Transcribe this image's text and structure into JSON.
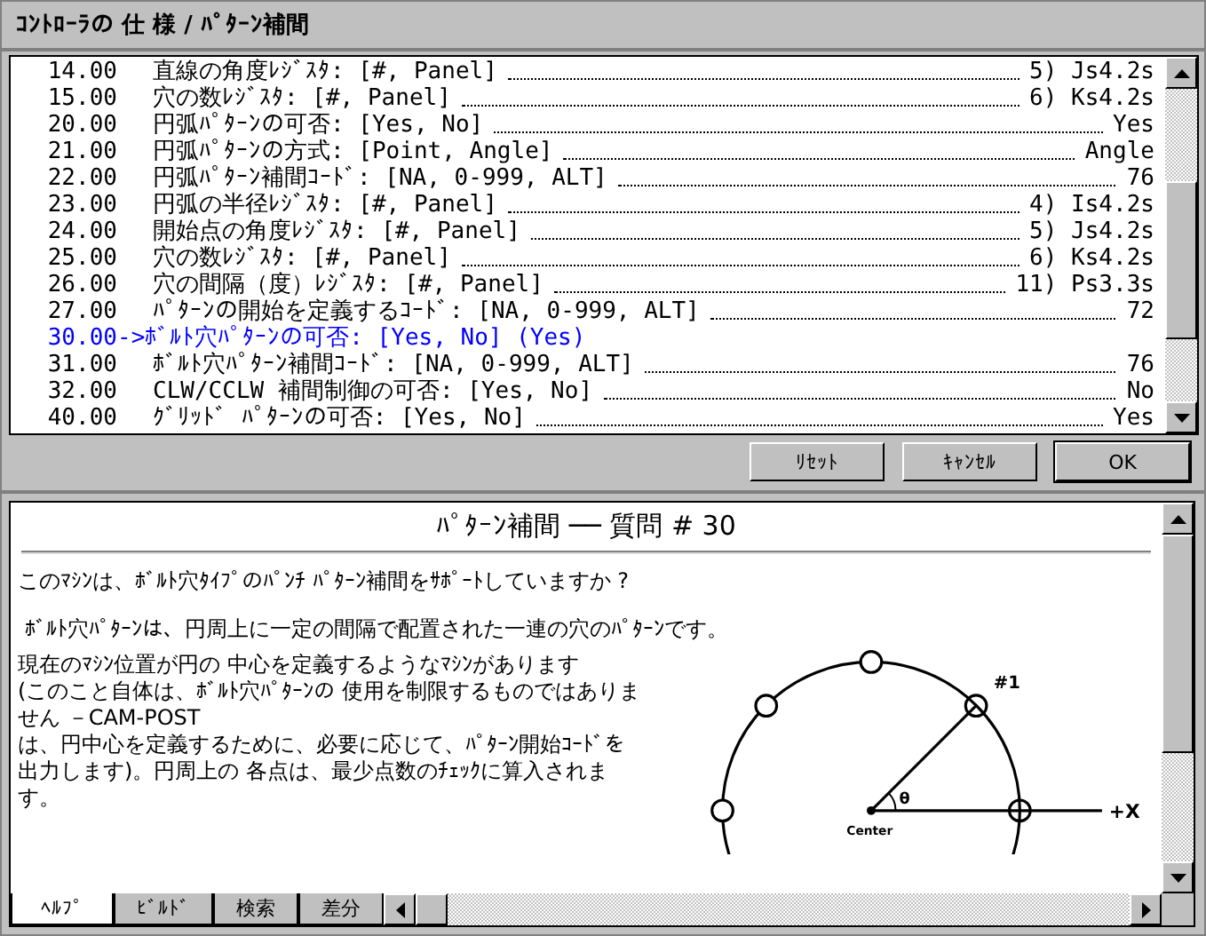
{
  "window": {
    "title": "ｺﾝﾄﾛｰﾗの 仕 様 / ﾊﾟﾀｰﾝ補間"
  },
  "rows": [
    {
      "number": "14.00",
      "text": "直線の角度ﾚｼﾞｽﾀ: [#, Panel]",
      "value": "5)  Js4.2s",
      "selected": false
    },
    {
      "number": "15.00",
      "text": "穴の数ﾚｼﾞｽﾀ: [#, Panel]",
      "value": "6)  Ks4.2s",
      "selected": false
    },
    {
      "number": "20.00",
      "text": "円弧ﾊﾟﾀｰﾝの可否: [Yes, No]",
      "value": "Yes",
      "selected": false
    },
    {
      "number": "21.00",
      "text": "円弧ﾊﾟﾀｰﾝの方式: [Point, Angle]",
      "value": "Angle",
      "selected": false
    },
    {
      "number": "22.00",
      "text": "円弧ﾊﾟﾀｰﾝ補間ｺｰﾄﾞ: [NA, 0-999, ALT]",
      "value": "76",
      "selected": false
    },
    {
      "number": "23.00",
      "text": "円弧の半径ﾚｼﾞｽﾀ: [#, Panel]",
      "value": "4)  Is4.2s",
      "selected": false
    },
    {
      "number": "24.00",
      "text": "開始点の角度ﾚｼﾞｽﾀ: [#, Panel]",
      "value": "5)  Js4.2s",
      "selected": false
    },
    {
      "number": "25.00",
      "text": "穴の数ﾚｼﾞｽﾀ: [#, Panel]",
      "value": "6)  Ks4.2s",
      "selected": false
    },
    {
      "number": "26.00",
      "text": "穴の間隔（度）ﾚｼﾞｽﾀ: [#, Panel]",
      "value": "11)  Ps3.3s",
      "selected": false
    },
    {
      "number": "27.00",
      "text": "ﾊﾟﾀｰﾝの開始を定義するｺｰﾄﾞ: [NA, 0-999, ALT]",
      "value": "72",
      "selected": false
    },
    {
      "number": "30.00",
      "text": "->ﾎﾞﾙﾄ穴ﾊﾟﾀｰﾝの可否: [Yes, No] (Yes)",
      "selected": true
    },
    {
      "number": "31.00",
      "text": "ﾎﾞﾙﾄ穴ﾊﾟﾀｰﾝ補間ｺｰﾄﾞ: [NA, 0-999, ALT]",
      "value": "76",
      "selected": false
    },
    {
      "number": "32.00",
      "text": "CLW/CCLW 補間制御の可否: [Yes, No]",
      "value": "No",
      "selected": false
    },
    {
      "number": "40.00",
      "text": "ｸﾞﾘｯﾄﾞ ﾊﾟﾀｰﾝの可否: [Yes, No]",
      "value": "Yes",
      "selected": false
    }
  ],
  "buttons": [
    "ﾘｾｯﾄ",
    "ｷｬﾝｾﾙ",
    "OK"
  ],
  "help": {
    "heading": "ﾊﾟﾀｰﾝ補間 ── 質問 # 30",
    "question": "このﾏｼﾝは、ﾎﾞﾙﾄ穴ﾀｲﾌﾟのﾊﾟﾝﾁ ﾊﾟﾀｰﾝ補間をｻﾎﾟｰﾄしていますか ?",
    "intro": "ﾎﾞﾙﾄ穴ﾊﾟﾀｰﾝは、円周上に一定の間隔で配置された一連の穴のﾊﾟﾀｰﾝです。",
    "body": "現在のﾏｼﾝ位置が円の 中心を定義するようなﾏｼﾝがあります\n(このこと自体は、ﾎﾞﾙﾄ穴ﾊﾟﾀｰﾝの 使用を制限するものではありません －CAM-POST\nは、円中心を定義するために、必要に応じて、ﾊﾟﾀｰﾝ開始ｺｰﾄﾞを出力します)。円周上の 各点は、最少点数のﾁｪｯｸに算入されます。",
    "diagram": {
      "hole_label": "#1",
      "angle_label": "θ",
      "center_label": "Center",
      "axis_label": "+X"
    }
  },
  "tabs": [
    {
      "label": "ﾍﾙﾌﾟ",
      "selected": true
    },
    {
      "label": "ﾋﾞﾙﾄﾞ",
      "selected": false
    },
    {
      "label": "検索",
      "selected": false
    },
    {
      "label": "差分",
      "selected": false
    }
  ]
}
